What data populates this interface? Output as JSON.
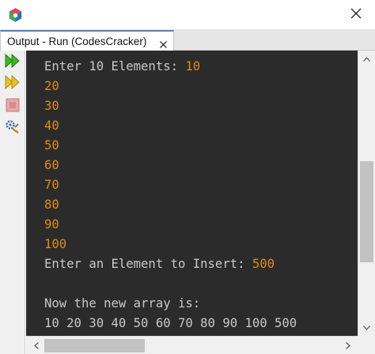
{
  "window": {
    "app_icon": "netbeans-cube-icon",
    "close_icon": "close-icon"
  },
  "tab": {
    "label": "Output - Run (CodesCracker)",
    "close_icon": "close-icon"
  },
  "toolbar": {
    "buttons": [
      {
        "name": "rerun",
        "icon": "rerun-icon"
      },
      {
        "name": "rerun-with-params",
        "icon": "rerun-params-icon"
      },
      {
        "name": "stop",
        "icon": "stop-icon"
      },
      {
        "name": "settings",
        "icon": "settings-icon"
      }
    ]
  },
  "console": {
    "lines": [
      {
        "text": "Enter 10 Elements: ",
        "input": "10"
      },
      {
        "text": "",
        "input": "20"
      },
      {
        "text": "",
        "input": "30"
      },
      {
        "text": "",
        "input": "40"
      },
      {
        "text": "",
        "input": "50"
      },
      {
        "text": "",
        "input": "60"
      },
      {
        "text": "",
        "input": "70"
      },
      {
        "text": "",
        "input": "80"
      },
      {
        "text": "",
        "input": "90"
      },
      {
        "text": "",
        "input": "100"
      },
      {
        "text": "Enter an Element to Insert: ",
        "input": "500"
      },
      {
        "text": "",
        "input": ""
      },
      {
        "text": "Now the new array is:",
        "input": ""
      },
      {
        "text": "10 20 30 40 50 60 70 80 90 100 500",
        "input": ""
      }
    ]
  },
  "scroll": {
    "vertical_position": 0.62,
    "vertical_visible": 0.4,
    "horizontal_position": 0.0,
    "horizontal_visible": 0.34
  },
  "colors": {
    "console_bg": "#2b2b2b",
    "output_text": "#c8c8c8",
    "input_text": "#e08b1c",
    "run_icon": "#3cb521"
  }
}
